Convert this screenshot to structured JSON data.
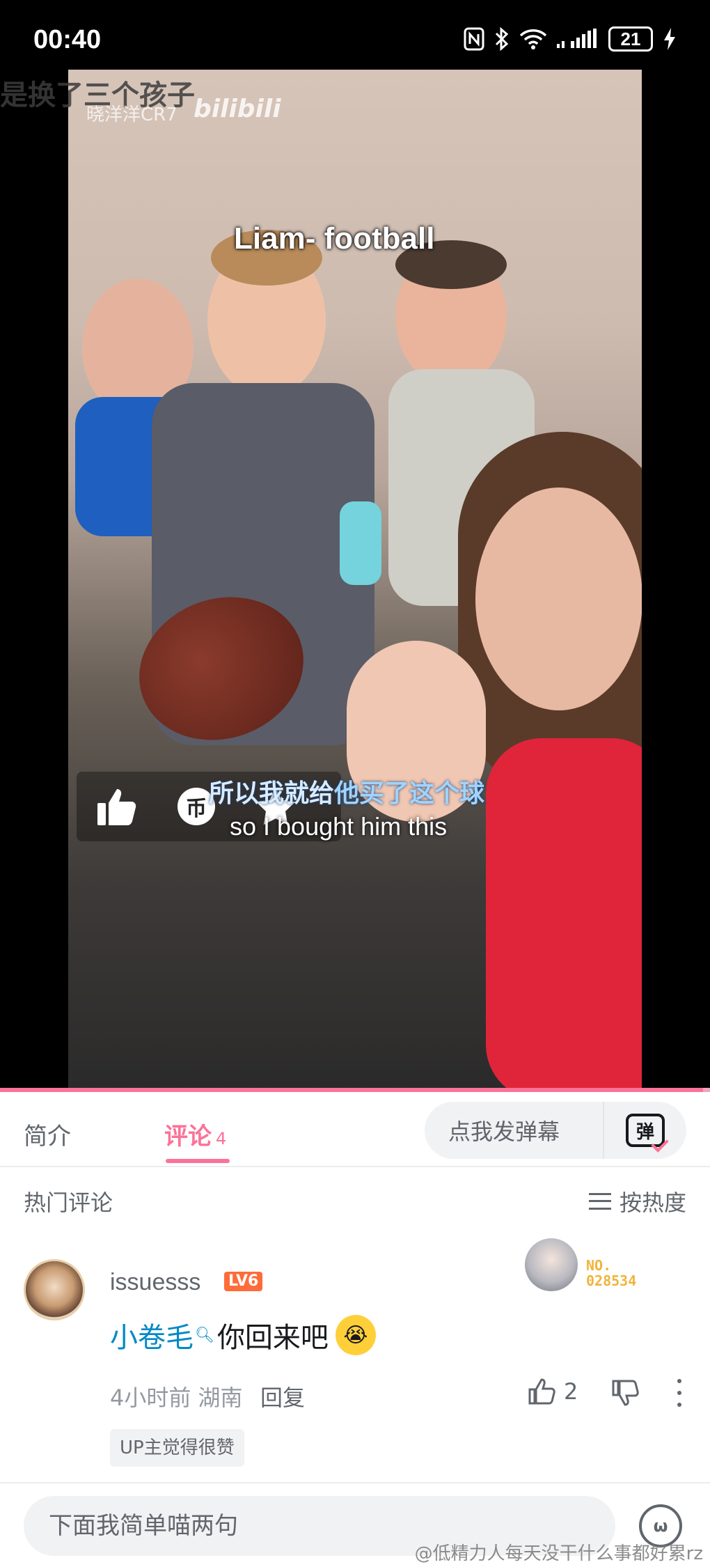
{
  "status_bar": {
    "time": "00:40",
    "battery": "21"
  },
  "video": {
    "banner_text": "是换了三个孩子",
    "uploader_watermark": "晓洋洋CR7",
    "logo_watermark": "bilibili",
    "caption_top": "Liam- football",
    "subtitle_cn_a": "所以我就给",
    "subtitle_cn_b": "他买了这个球",
    "subtitle_en": "so I bought him this",
    "progress_fraction": 0.99,
    "coin_glyph": "币"
  },
  "tabs": {
    "intro": "简介",
    "comments": "评论",
    "comment_count": "4",
    "danmaku_placeholder": "点我发弹幕",
    "danmaku_icon_glyph": "弹"
  },
  "comments_header": {
    "title": "热门评论",
    "sort_label": "按热度"
  },
  "comment": {
    "username": "issuesss",
    "level": "LV6",
    "fan_badge_no": "NO.",
    "fan_badge_num": "028534",
    "mention": "小卷毛",
    "text": "你回来吧",
    "emoji": "😭",
    "time_location": "4小时前  湖南",
    "reply": "回复",
    "likes": "2",
    "tag": "UP主觉得很赞"
  },
  "bottom": {
    "input_placeholder": "下面我简单喵两句",
    "emoji_glyph": "ω",
    "weibo_watermark": "@低精力人每天没干什么事都好累rz"
  },
  "colors": {
    "brand_pink": "#fb7299",
    "mention_blue": "#008ac5",
    "level_orange": "#fe6c3a"
  }
}
